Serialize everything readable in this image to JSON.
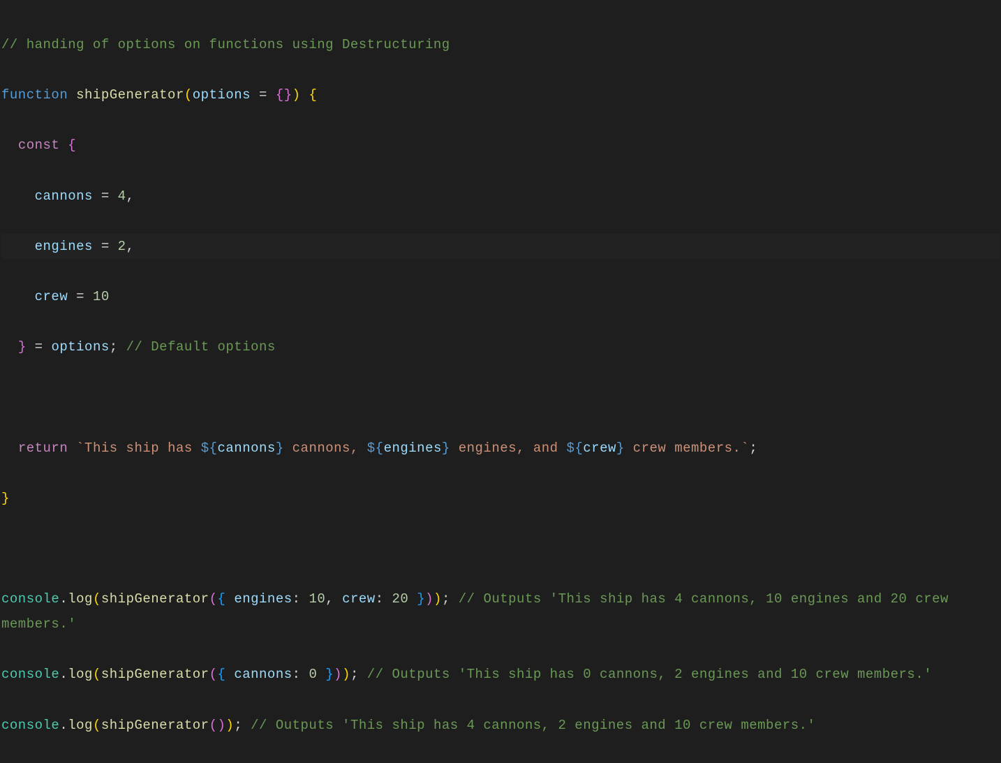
{
  "code": {
    "line1": {
      "comment": "// handing of options on functions using Destructuring"
    },
    "line2": {
      "function": "function",
      "funcName": "shipGenerator",
      "paren1": "(",
      "param": "options",
      "equals": " = ",
      "braceOpen": "{",
      "braceClose": "}",
      "paren2": ")",
      "space": " ",
      "funcBrace": "{"
    },
    "line3": {
      "indent": "  ",
      "const": "const",
      "space": " ",
      "brace": "{"
    },
    "line4": {
      "indent": "    ",
      "prop": "cannons",
      "equals": " = ",
      "num": "4",
      "comma": ","
    },
    "line5": {
      "indent": "    ",
      "prop": "engines",
      "equals": " = ",
      "num": "2",
      "comma": ","
    },
    "line6": {
      "indent": "    ",
      "prop": "crew",
      "equals": " = ",
      "num": "10"
    },
    "line7": {
      "indent": "  ",
      "brace": "}",
      "equals": " = ",
      "var": "options",
      "semi": ";",
      "comment": " // Default options"
    },
    "line8": {
      "blank": ""
    },
    "line9": {
      "indent": "  ",
      "return": "return",
      "space": " ",
      "backtick1": "`",
      "str1": "This ship has ",
      "dollar1": "${",
      "var1": "cannons",
      "close1": "}",
      "str2": " cannons, ",
      "dollar2": "${",
      "var2": "engines",
      "close2": "}",
      "str3": " engines, and ",
      "dollar3": "${",
      "var3": "crew",
      "close3": "}",
      "str4": " crew members.",
      "backtick2": "`",
      "semi": ";"
    },
    "line10": {
      "brace": "}"
    },
    "line11": {
      "blank": ""
    },
    "line12": {
      "obj": "console",
      "dot": ".",
      "method": "log",
      "paren1": "(",
      "func": "shipGenerator",
      "paren2": "(",
      "brace1": "{",
      "space1": " ",
      "prop1": "engines",
      "colon1": ":",
      "space2": " ",
      "num1": "10",
      "comma1": ",",
      "space3": " ",
      "prop2": "crew",
      "colon2": ":",
      "space4": " ",
      "num2": "20",
      "space5": " ",
      "brace2": "}",
      "paren3": ")",
      "paren4": ")",
      "semi": ";",
      "comment": " // Outputs 'This ship has 4 cannons, 10 engines and 20 crew members.'"
    },
    "line13": {
      "obj": "console",
      "dot": ".",
      "method": "log",
      "paren1": "(",
      "func": "shipGenerator",
      "paren2": "(",
      "brace1": "{",
      "space1": " ",
      "prop1": "cannons",
      "colon1": ":",
      "space2": " ",
      "num1": "0",
      "space3": " ",
      "brace2": "}",
      "paren3": ")",
      "paren4": ")",
      "semi": ";",
      "comment": " // Outputs 'This ship has 0 cannons, 2 engines and 10 crew members.'"
    },
    "line14": {
      "obj": "console",
      "dot": ".",
      "method": "log",
      "paren1": "(",
      "func": "shipGenerator",
      "paren2": "(",
      "paren3": ")",
      "paren4": ")",
      "semi": ";",
      "comment": " // Outputs 'This ship has 4 cannons, 2 engines and 10 crew members.'"
    }
  }
}
